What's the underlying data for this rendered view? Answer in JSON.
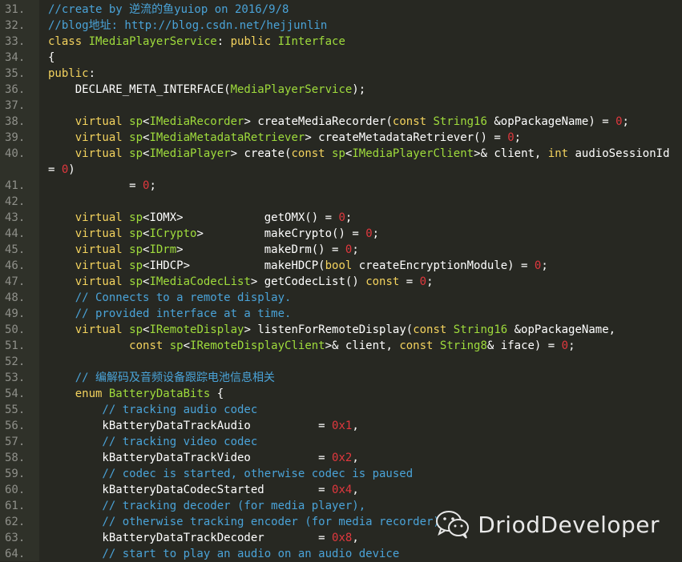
{
  "palette": {
    "background": "#272822",
    "gutter": "#2f3129",
    "line_number": "#8f908a",
    "keyword": "#f4d35e",
    "class_name": "#9fdc3c",
    "number": "#e0383e",
    "comment": "#4aa3d8",
    "text": "#ffffff"
  },
  "watermark": {
    "icon": "wechat-icon",
    "text": "DriodDeveloper"
  },
  "lines": [
    {
      "n": "31.",
      "tokens": [
        [
          "c-com",
          "//create by 逆流的鱼yuiop on 2016/9/8"
        ]
      ]
    },
    {
      "n": "32.",
      "tokens": [
        [
          "c-com",
          "//blog地址: http://blog.csdn.net/hejjunlin"
        ]
      ]
    },
    {
      "n": "33.",
      "tokens": [
        [
          "c-kw",
          "class "
        ],
        [
          "c-cls",
          "IMediaPlayerService"
        ],
        [
          "c-txt",
          ": "
        ],
        [
          "c-kw",
          "public "
        ],
        [
          "c-cls",
          "IInterface"
        ]
      ]
    },
    {
      "n": "34.",
      "tokens": [
        [
          "c-txt",
          "{"
        ]
      ]
    },
    {
      "n": "35.",
      "tokens": [
        [
          "c-kw",
          "public"
        ],
        [
          "c-txt",
          ":"
        ]
      ]
    },
    {
      "n": "36.",
      "tokens": [
        [
          "c-txt",
          "    DECLARE_META_INTERFACE("
        ],
        [
          "c-cls",
          "MediaPlayerService"
        ],
        [
          "c-txt",
          ");"
        ]
      ]
    },
    {
      "n": "37.",
      "tokens": []
    },
    {
      "n": "38.",
      "tokens": [
        [
          "c-txt",
          "    "
        ],
        [
          "c-kw",
          "virtual "
        ],
        [
          "c-cls",
          "sp"
        ],
        [
          "c-txt",
          "<"
        ],
        [
          "c-cls",
          "IMediaRecorder"
        ],
        [
          "c-txt",
          "> createMediaRecorder("
        ],
        [
          "c-kw",
          "const "
        ],
        [
          "c-cls",
          "String16 "
        ],
        [
          "c-txt",
          "&opPackageName) = "
        ],
        [
          "c-num",
          "0"
        ],
        [
          "c-txt",
          ";"
        ]
      ]
    },
    {
      "n": "39.",
      "tokens": [
        [
          "c-txt",
          "    "
        ],
        [
          "c-kw",
          "virtual "
        ],
        [
          "c-cls",
          "sp"
        ],
        [
          "c-txt",
          "<"
        ],
        [
          "c-cls",
          "IMediaMetadataRetriever"
        ],
        [
          "c-txt",
          "> createMetadataRetriever() = "
        ],
        [
          "c-num",
          "0"
        ],
        [
          "c-txt",
          ";"
        ]
      ]
    },
    {
      "n": "40.",
      "tokens": [
        [
          "c-txt",
          "    "
        ],
        [
          "c-kw",
          "virtual "
        ],
        [
          "c-cls",
          "sp"
        ],
        [
          "c-txt",
          "<"
        ],
        [
          "c-cls",
          "IMediaPlayer"
        ],
        [
          "c-txt",
          "> create("
        ],
        [
          "c-kw",
          "const "
        ],
        [
          "c-cls",
          "sp"
        ],
        [
          "c-txt",
          "<"
        ],
        [
          "c-cls",
          "IMediaPlayerClient"
        ],
        [
          "c-txt",
          ">& client, "
        ],
        [
          "c-kw",
          "int "
        ],
        [
          "c-txt",
          "audioSessionId"
        ]
      ]
    },
    {
      "n": "",
      "tokens": [
        [
          "c-txt",
          "= "
        ],
        [
          "c-num",
          "0"
        ],
        [
          "c-txt",
          ")"
        ]
      ],
      "wrap": true
    },
    {
      "n": "41.",
      "tokens": [
        [
          "c-txt",
          "            = "
        ],
        [
          "c-num",
          "0"
        ],
        [
          "c-txt",
          ";"
        ]
      ]
    },
    {
      "n": "42.",
      "tokens": []
    },
    {
      "n": "43.",
      "tokens": [
        [
          "c-txt",
          "    "
        ],
        [
          "c-kw",
          "virtual "
        ],
        [
          "c-cls",
          "sp"
        ],
        [
          "c-txt",
          "<IOMX>            getOMX() = "
        ],
        [
          "c-num",
          "0"
        ],
        [
          "c-txt",
          ";"
        ]
      ]
    },
    {
      "n": "44.",
      "tokens": [
        [
          "c-txt",
          "    "
        ],
        [
          "c-kw",
          "virtual "
        ],
        [
          "c-cls",
          "sp"
        ],
        [
          "c-txt",
          "<"
        ],
        [
          "c-cls",
          "ICrypto"
        ],
        [
          "c-txt",
          ">         makeCrypto() = "
        ],
        [
          "c-num",
          "0"
        ],
        [
          "c-txt",
          ";"
        ]
      ]
    },
    {
      "n": "45.",
      "tokens": [
        [
          "c-txt",
          "    "
        ],
        [
          "c-kw",
          "virtual "
        ],
        [
          "c-cls",
          "sp"
        ],
        [
          "c-txt",
          "<"
        ],
        [
          "c-cls",
          "IDrm"
        ],
        [
          "c-txt",
          ">            makeDrm() = "
        ],
        [
          "c-num",
          "0"
        ],
        [
          "c-txt",
          ";"
        ]
      ]
    },
    {
      "n": "46.",
      "tokens": [
        [
          "c-txt",
          "    "
        ],
        [
          "c-kw",
          "virtual "
        ],
        [
          "c-cls",
          "sp"
        ],
        [
          "c-txt",
          "<IHDCP>           makeHDCP("
        ],
        [
          "c-kw",
          "bool "
        ],
        [
          "c-txt",
          "createEncryptionModule) = "
        ],
        [
          "c-num",
          "0"
        ],
        [
          "c-txt",
          ";"
        ]
      ]
    },
    {
      "n": "47.",
      "tokens": [
        [
          "c-txt",
          "    "
        ],
        [
          "c-kw",
          "virtual "
        ],
        [
          "c-cls",
          "sp"
        ],
        [
          "c-txt",
          "<"
        ],
        [
          "c-cls",
          "IMediaCodecList"
        ],
        [
          "c-txt",
          "> getCodecList() "
        ],
        [
          "c-kw",
          "const"
        ],
        [
          "c-txt",
          " = "
        ],
        [
          "c-num",
          "0"
        ],
        [
          "c-txt",
          ";"
        ]
      ]
    },
    {
      "n": "48.",
      "tokens": [
        [
          "c-com",
          "    // Connects to a remote display."
        ]
      ]
    },
    {
      "n": "49.",
      "tokens": [
        [
          "c-com",
          "    // provided interface at a time."
        ]
      ]
    },
    {
      "n": "50.",
      "tokens": [
        [
          "c-txt",
          "    "
        ],
        [
          "c-kw",
          "virtual "
        ],
        [
          "c-cls",
          "sp"
        ],
        [
          "c-txt",
          "<"
        ],
        [
          "c-cls",
          "IRemoteDisplay"
        ],
        [
          "c-txt",
          "> listenForRemoteDisplay("
        ],
        [
          "c-kw",
          "const "
        ],
        [
          "c-cls",
          "String16 "
        ],
        [
          "c-txt",
          "&opPackageName,"
        ]
      ]
    },
    {
      "n": "51.",
      "tokens": [
        [
          "c-txt",
          "            "
        ],
        [
          "c-kw",
          "const "
        ],
        [
          "c-cls",
          "sp"
        ],
        [
          "c-txt",
          "<"
        ],
        [
          "c-cls",
          "IRemoteDisplayClient"
        ],
        [
          "c-txt",
          ">& client, "
        ],
        [
          "c-kw",
          "const "
        ],
        [
          "c-cls",
          "String8"
        ],
        [
          "c-txt",
          "& iface) = "
        ],
        [
          "c-num",
          "0"
        ],
        [
          "c-txt",
          ";"
        ]
      ]
    },
    {
      "n": "52.",
      "tokens": []
    },
    {
      "n": "53.",
      "tokens": [
        [
          "c-com",
          "    // 编解码及音频设备跟踪电池信息相关"
        ]
      ]
    },
    {
      "n": "54.",
      "tokens": [
        [
          "c-txt",
          "    "
        ],
        [
          "c-kw",
          "enum "
        ],
        [
          "c-cls",
          "BatteryDataBits "
        ],
        [
          "c-txt",
          "{"
        ]
      ]
    },
    {
      "n": "55.",
      "tokens": [
        [
          "c-com",
          "        // tracking audio codec"
        ]
      ]
    },
    {
      "n": "56.",
      "tokens": [
        [
          "c-txt",
          "        kBatteryDataTrackAudio          = "
        ],
        [
          "c-num",
          "0x1"
        ],
        [
          "c-txt",
          ","
        ]
      ]
    },
    {
      "n": "57.",
      "tokens": [
        [
          "c-com",
          "        // tracking video codec"
        ]
      ]
    },
    {
      "n": "58.",
      "tokens": [
        [
          "c-txt",
          "        kBatteryDataTrackVideo          = "
        ],
        [
          "c-num",
          "0x2"
        ],
        [
          "c-txt",
          ","
        ]
      ]
    },
    {
      "n": "59.",
      "tokens": [
        [
          "c-com",
          "        // codec is started, otherwise codec is paused"
        ]
      ]
    },
    {
      "n": "60.",
      "tokens": [
        [
          "c-txt",
          "        kBatteryDataCodecStarted        = "
        ],
        [
          "c-num",
          "0x4"
        ],
        [
          "c-txt",
          ","
        ]
      ]
    },
    {
      "n": "61.",
      "tokens": [
        [
          "c-com",
          "        // tracking decoder (for media player),"
        ]
      ]
    },
    {
      "n": "62.",
      "tokens": [
        [
          "c-com",
          "        // otherwise tracking encoder (for media recorder)"
        ]
      ]
    },
    {
      "n": "63.",
      "tokens": [
        [
          "c-txt",
          "        kBatteryDataTrackDecoder        = "
        ],
        [
          "c-num",
          "0x8"
        ],
        [
          "c-txt",
          ","
        ]
      ]
    },
    {
      "n": "64.",
      "tokens": [
        [
          "c-com",
          "        // start to play an audio on an audio device"
        ]
      ]
    }
  ]
}
